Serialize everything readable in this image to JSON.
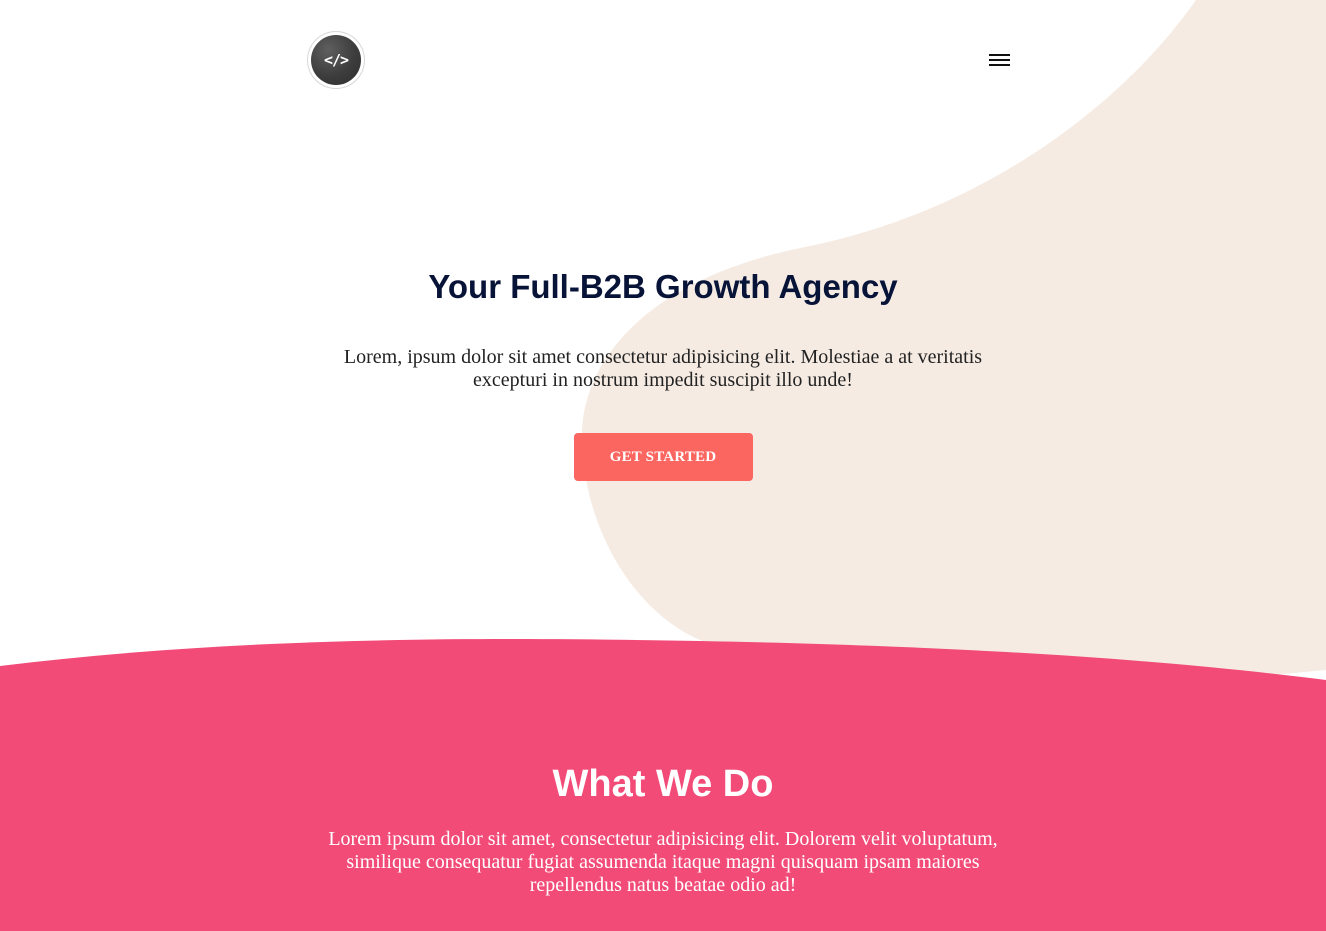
{
  "header": {
    "logo_text": "</>",
    "menu_icon": "hamburger-icon"
  },
  "hero": {
    "title": "Your Full-B2B Growth Agency",
    "description": "Lorem, ipsum dolor sit amet consectetur adipisicing elit. Molestiae a at veritatis excepturi in nostrum impedit suscipit illo unde!",
    "cta_label": "GET STARTED"
  },
  "what_we_do": {
    "title": "What We Do",
    "description": "Lorem ipsum dolor sit amet, consectetur adipisicing elit. Dolorem velit voluptatum, similique consequatur fugiat assumenda itaque magni quisquam ipsam maiores repellendus natus beatae odio ad!"
  },
  "colors": {
    "hero_shape": "#f5ebe3",
    "cta": "#fb6661",
    "section_bg": "#f24b78",
    "title_dark": "#081338"
  }
}
